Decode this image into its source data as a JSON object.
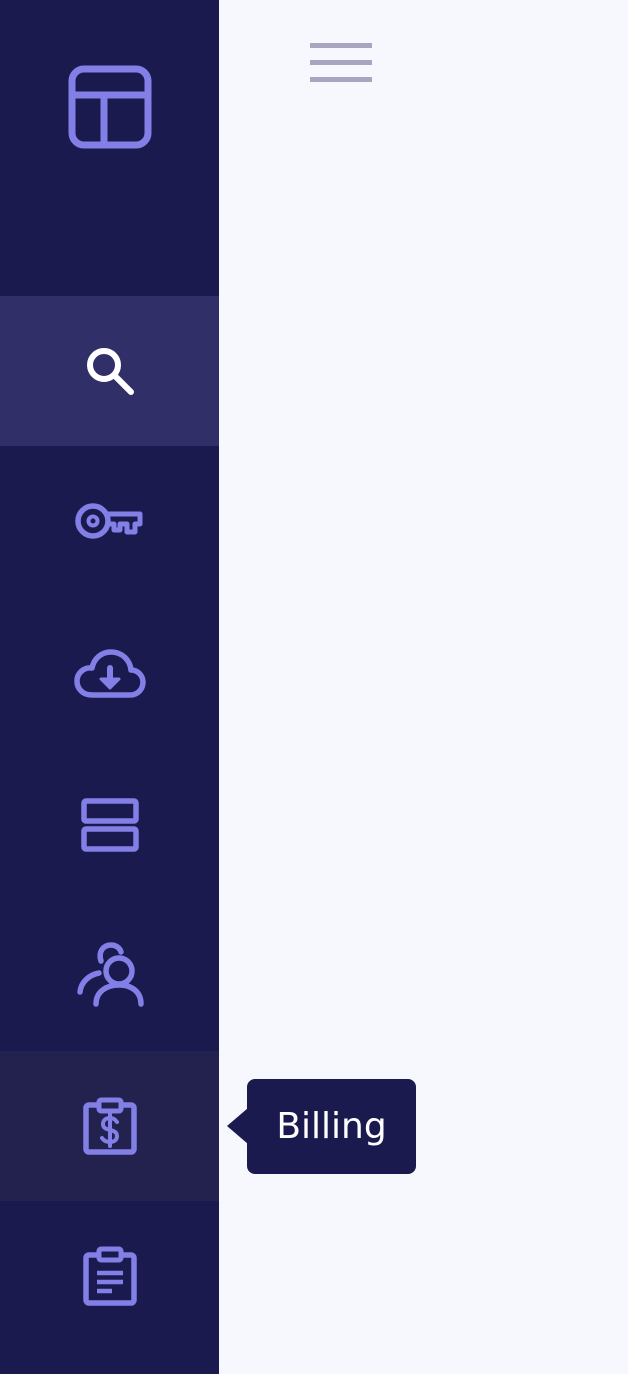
{
  "sidebar": {
    "logo_icon": "layout-icon",
    "items": [
      {
        "key": "search",
        "icon": "search-icon",
        "state": "active"
      },
      {
        "key": "keys",
        "icon": "key-icon",
        "state": "normal"
      },
      {
        "key": "downloads",
        "icon": "cloud-download-icon",
        "state": "normal"
      },
      {
        "key": "storage",
        "icon": "server-rows-icon",
        "state": "normal"
      },
      {
        "key": "users",
        "icon": "users-icon",
        "state": "normal"
      },
      {
        "key": "billing",
        "icon": "billing-clipboard-icon",
        "state": "hover"
      },
      {
        "key": "reports",
        "icon": "clipboard-list-icon",
        "state": "normal"
      }
    ]
  },
  "header": {
    "menu_icon": "hamburger-menu-icon"
  },
  "tooltip": {
    "text": "Billing"
  },
  "colors": {
    "sidebar_bg": "#1b1a4f",
    "sidebar_active_bg": "#312f68",
    "sidebar_hover_bg": "#23224f",
    "icon_accent": "#8280e6",
    "icon_active": "#ffffff",
    "main_bg": "#f7f8fd",
    "menu_icon_color": "#a7a6c0"
  }
}
